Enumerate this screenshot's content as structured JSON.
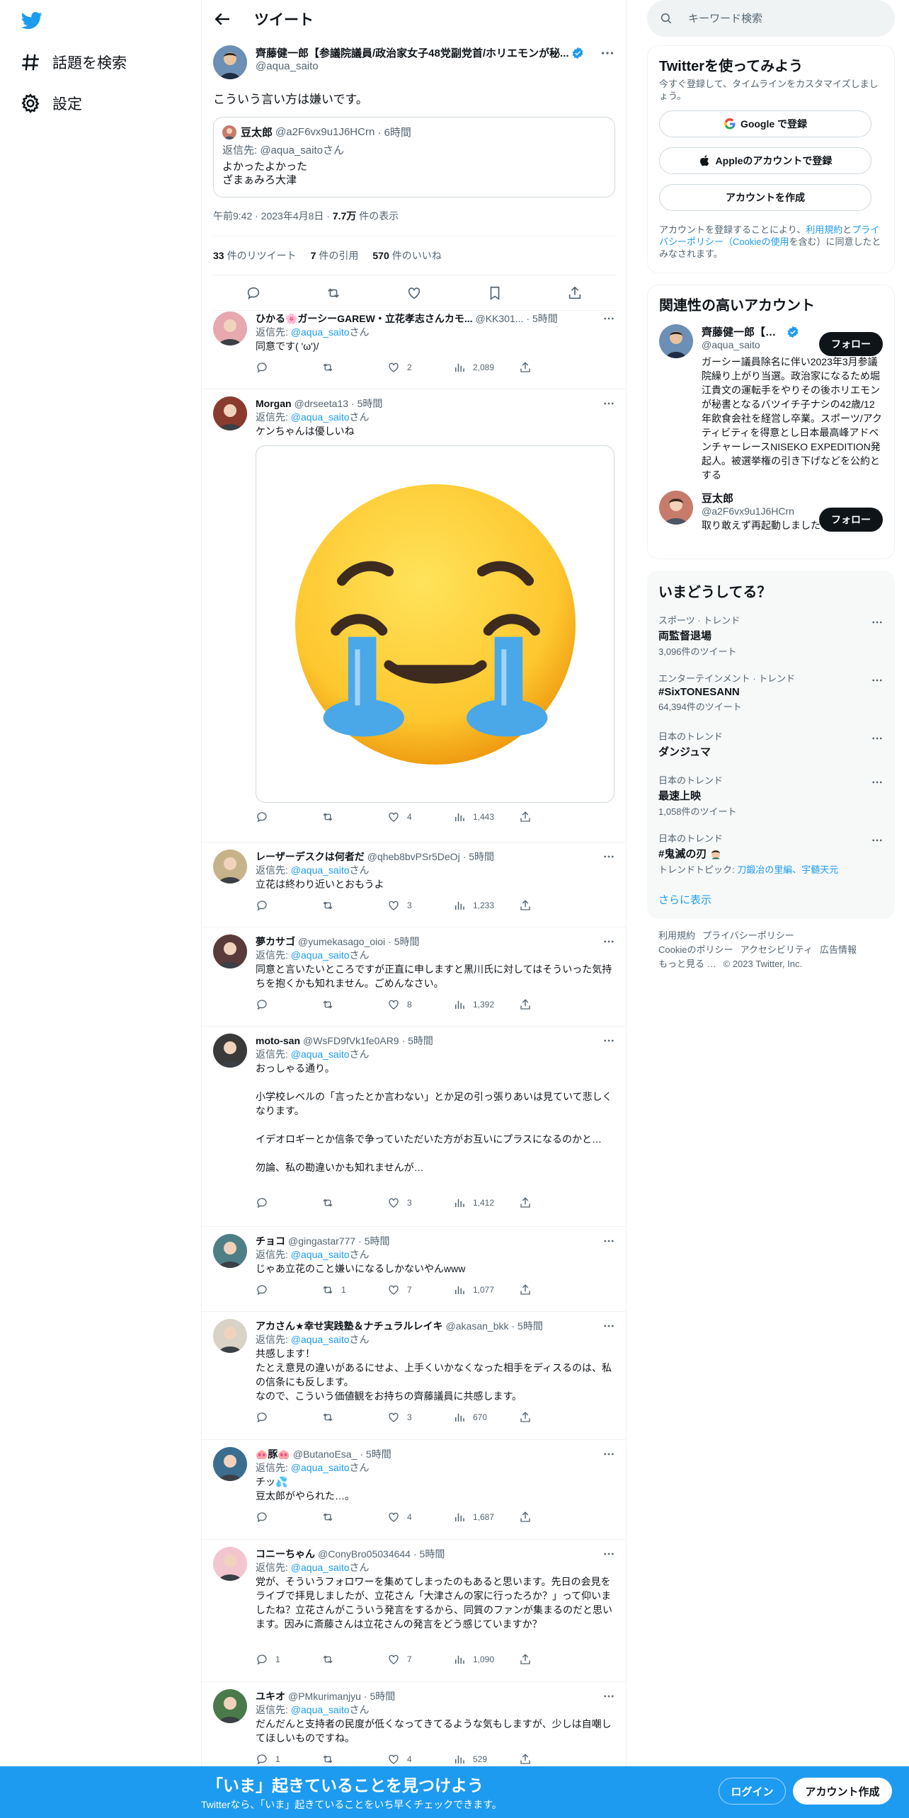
{
  "nav": {
    "explore_label": "話題を検索",
    "settings_label": "設定"
  },
  "header": {
    "title": "ツイート"
  },
  "main_tweet": {
    "author_name": "齊藤健一郎【参議院議員/政治家女子48党副党首/ホリエモンが秘...",
    "author_handle": "@aqua_saito",
    "text": "こういう言い方は嫌いです。",
    "quote": {
      "author_name": "豆太郎",
      "author_handle": "@a2F6vx9u1J6HCrn",
      "time": "· 6時間",
      "reply_to": "返信先: @aqua_saitoさん",
      "text_line1": "よかったよかった",
      "text_line2": "ざまぁみろ大津"
    },
    "time": "午前9:42 · 2023年4月8日 · ",
    "views_count": "7.7万",
    "views_label": " 件の表示",
    "retweets_count": "33",
    "retweets_label": "件のリツイート",
    "quotes_count": "7",
    "quotes_label": "件の引用",
    "likes_count": "570",
    "likes_label": "件のいいね"
  },
  "replies": [
    {
      "name": "ひかる🌸ガーシーGAREW・立花孝志さんカモ...",
      "handle": "@KK301...",
      "time": "· 5時間",
      "reply_prefix": "返信先: ",
      "reply_link": "@aqua_saito",
      "reply_suffix": "さん",
      "text": "同意です( 'ω')/",
      "replies": "",
      "retweets": "",
      "likes": "2",
      "views": "2,089"
    },
    {
      "name": "Morgan",
      "handle": "@drseeta13",
      "time": "· 5時間",
      "reply_prefix": "返信先: ",
      "reply_link": "@aqua_saito",
      "reply_suffix": "さん",
      "text": "ケンちゃんは優しいね",
      "replies": "",
      "retweets": "",
      "likes": "4",
      "views": "1,443"
    },
    {
      "name": "レーザーデスクは何者だ",
      "handle": "@qheb8bvPSr5DeOj",
      "time": "· 5時間",
      "reply_prefix": "返信先: ",
      "reply_link": "@aqua_saito",
      "reply_suffix": "さん",
      "text": "立花は終わり近いとおもうよ",
      "replies": "",
      "retweets": "",
      "likes": "3",
      "views": "1,233"
    },
    {
      "name": "夢カサゴ",
      "handle": "@yumekasago_oioi",
      "time": "· 5時間",
      "reply_prefix": "返信先: ",
      "reply_link": "@aqua_saito",
      "reply_suffix": "さん",
      "text": "同意と言いたいところですが正直に申しますと黒川氏に対してはそういった気持ちを抱くかも知れません。ごめんなさい。",
      "replies": "",
      "retweets": "",
      "likes": "8",
      "views": "1,392"
    },
    {
      "name": "moto-san",
      "handle": "@WsFD9fVk1fe0AR9",
      "time": "· 5時間",
      "reply_prefix": "返信先: ",
      "reply_link": "@aqua_saito",
      "reply_suffix": "さん",
      "text": "おっしゃる通り。\n\n小学校レベルの「言ったとか言わない」とか足の引っ張りあいは見ていて悲しくなります。\n\nイデオロギーとか信条で争っていただいた方がお互いにプラスになるのかと…\n\n勿論、私の勘違いかも知れませんが…",
      "replies": "",
      "retweets": "",
      "likes": "3",
      "views": "1,412"
    },
    {
      "name": "チョコ",
      "handle": "@gingastar777",
      "time": "· 5時間",
      "reply_prefix": "返信先: ",
      "reply_link": "@aqua_saito",
      "reply_suffix": "さん",
      "text": "じゃあ立花のこと嫌いになるしかないやんwww",
      "replies": "",
      "retweets": "1",
      "likes": "7",
      "views": "1,077"
    },
    {
      "name": "アカさん★幸せ実践塾＆ナチュラルレイキ",
      "handle": "@akasan_bkk",
      "time": "· 5時間",
      "reply_prefix": "返信先: ",
      "reply_link": "@aqua_saito",
      "reply_suffix": "さん",
      "text": "共感します！\nたとえ意見の違いがあるにせよ、上手くいかなくなった相手をディスるのは、私の信条にも反します。\nなので、こういう価値観をお持ちの齊藤議員に共感します。",
      "replies": "",
      "retweets": "",
      "likes": "3",
      "views": "670"
    },
    {
      "name": "🐽豚🐽",
      "handle": "@ButanoEsa_",
      "time": "· 5時間",
      "reply_prefix": "返信先: ",
      "reply_link": "@aqua_saito",
      "reply_suffix": "さん",
      "text": "チッ💦\n豆太郎がやられた…。",
      "replies": "",
      "retweets": "",
      "likes": "4",
      "views": "1,687"
    },
    {
      "name": "コニーちゃん",
      "handle": "@ConyBro05034644",
      "time": "· 5時間",
      "reply_prefix": "返信先: ",
      "reply_link": "@aqua_saito",
      "reply_suffix": "さん",
      "text": "党が、そういうフォロワーを集めてしまったのもあると思います。先日の会見をライブで拝見しましたが、立花さん「大津さんの家に行ったろか？」って仰いましたね？立花さんがこういう発言をするから、同質のファンが集まるのだと思います。因みに斎藤さんは立花さんの発言をどう感じていますか？",
      "replies": "1",
      "retweets": "",
      "likes": "7",
      "views": "1,090"
    },
    {
      "name": "ユキオ",
      "handle": "@PMkurimanjyu",
      "time": "· 5時間",
      "reply_prefix": "返信先: ",
      "reply_link": "@aqua_saito",
      "reply_suffix": "さん",
      "text": "だんだんと支持者の民度が低くなってきてるような気もしますが、少しは自嘲してほしいものですね。",
      "replies": "1",
      "retweets": "",
      "likes": "4",
      "views": "529"
    }
  ],
  "search": {
    "placeholder": "キーワード検索"
  },
  "signup": {
    "title": "Twitterを使ってみよう",
    "subtitle": "今すぐ登録して、タイムラインをカスタマイズしましょう。",
    "google_label": "Google で登録",
    "apple_label": "Appleのアカウントで登録",
    "create_label": "アカウントを作成",
    "legal_prefix": "アカウントを登録することにより、",
    "legal_link1": "利用規約",
    "legal_mid1": "と",
    "legal_link2": "プライバシーポリシー（Cookieの使用",
    "legal_suffix": "を含む）に同意したとみなされます。"
  },
  "related": {
    "title": "関連性の高いアカウント",
    "accounts": [
      {
        "name": "齊藤健一郎【参議...",
        "handle": "@aqua_saito",
        "bio": "ガーシー議員除名に伴い2023年3月参議院繰り上がり当選。政治家になるため堀江貴文の運転手をやりその後ホリエモンが秘書となるバツイチ子ナシの42歳/12年飲食会社を経営し卒業。スポーツ/アクティビティを得意とし日本最高峰アドベンチャーレースNISEKO EXPEDITION発起人。被選挙権の引き下げなどを公約とする",
        "follow_label": "フォロー"
      },
      {
        "name": "豆太郎",
        "handle": "@a2F6vx9u1J6HCrn",
        "bio": "取り敢えず再起動しました",
        "follow_label": "フォロー"
      }
    ]
  },
  "trends": {
    "title": "いまどうしてる？",
    "items": [
      {
        "context": "スポーツ · トレンド",
        "name": "両監督退場",
        "count": "3,096件のツイート"
      },
      {
        "context": "エンターテインメント · トレンド",
        "name": "#SixTONESANN",
        "count": "64,394件のツイート"
      },
      {
        "context": "日本のトレンド",
        "name": "ダンジュマ",
        "count": ""
      },
      {
        "context": "日本のトレンド",
        "name": "最速上映",
        "count": "1,058件のツイート"
      },
      {
        "context": "日本のトレンド",
        "name": "#鬼滅の刃",
        "count_prefix": "トレンドトピック: ",
        "count_link": "刀鍛冶の里編、宇髄天元"
      }
    ],
    "show_more": "さらに表示"
  },
  "footer": {
    "links": [
      "利用規約",
      "プライバシーポリシー",
      "Cookieのポリシー",
      "アクセシビリティ",
      "広告情報",
      "もっと見る …"
    ],
    "copyright": "© 2023 Twitter, Inc."
  },
  "bottom_bar": {
    "title": "「いま」起きていることを見つけよう",
    "subtitle": "Twitterなら、「いま」起きていることをいち早くチェックできます。",
    "login_label": "ログイン",
    "signup_label": "アカウント作成"
  },
  "colors": {
    "brand": "#1d9bf0",
    "text": "#0f1419",
    "muted": "#536471"
  }
}
